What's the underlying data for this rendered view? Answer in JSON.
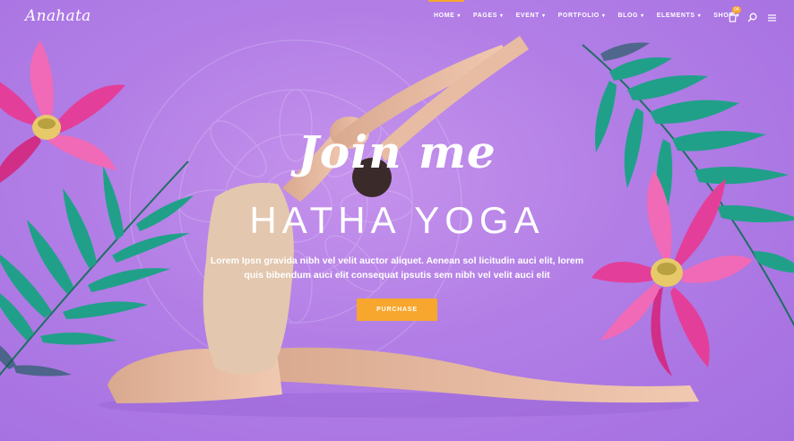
{
  "header": {
    "logo": "Anahata",
    "nav": [
      {
        "label": "HOME"
      },
      {
        "label": "PAGES"
      },
      {
        "label": "EVENT"
      },
      {
        "label": "PORTFOLIO"
      },
      {
        "label": "BLOG"
      },
      {
        "label": "ELEMENTS"
      },
      {
        "label": "SHOP"
      }
    ],
    "cart_count": "04",
    "icons": [
      "cart-icon",
      "search-icon",
      "menu-icon"
    ]
  },
  "hero": {
    "script_title": "Join me",
    "title": "HATHA YOGA",
    "description": "Lorem Ipsn gravida nibh vel velit auctor aliquet. Aenean sol licitudin auci elit, lorem quis bibendum auci elit consequat ipsutis sem nibh vel velit auci elit",
    "button_label": "PURCHASE"
  },
  "colors": {
    "background": "#b27ee6",
    "accent": "#f7a72d",
    "text": "#ffffff"
  }
}
